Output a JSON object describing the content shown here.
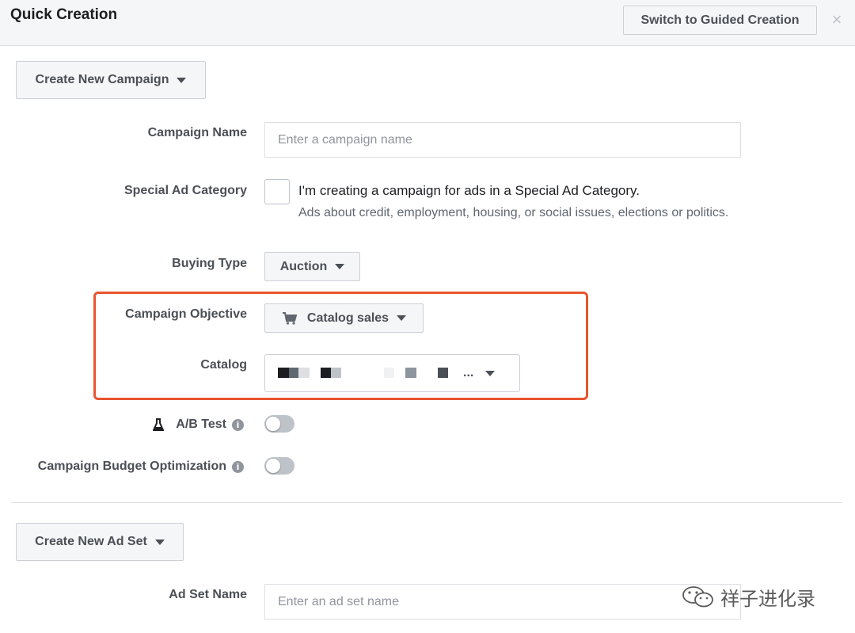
{
  "header": {
    "title": "Quick Creation",
    "guided_button": "Switch to Guided Creation",
    "close_glyph": "×"
  },
  "campaign": {
    "create_button": "Create New Campaign",
    "name_label": "Campaign Name",
    "name_placeholder": "Enter a campaign name",
    "special_label": "Special Ad Category",
    "special_text": "I'm creating a campaign for ads in a Special Ad Category.",
    "special_sub": "Ads about credit, employment, housing, or social issues, elections or politics.",
    "buying_label": "Buying Type",
    "buying_value": "Auction",
    "objective_label": "Campaign Objective",
    "objective_value": "Catalog sales",
    "objective_icon": "cart-icon",
    "catalog_label": "Catalog",
    "catalog_ellipsis": "...",
    "ab_label": "A/B Test",
    "ab_icon": "flask-icon",
    "cbo_label": "Campaign Budget Optimization",
    "info_glyph": "i"
  },
  "adset": {
    "create_button": "Create New Ad Set",
    "name_label": "Ad Set Name",
    "name_placeholder": "Enter an ad set name"
  },
  "watermark": {
    "text": "祥子进化录"
  },
  "colors": {
    "highlight": "#e8552f",
    "toggle_off": "#bec3c9"
  }
}
